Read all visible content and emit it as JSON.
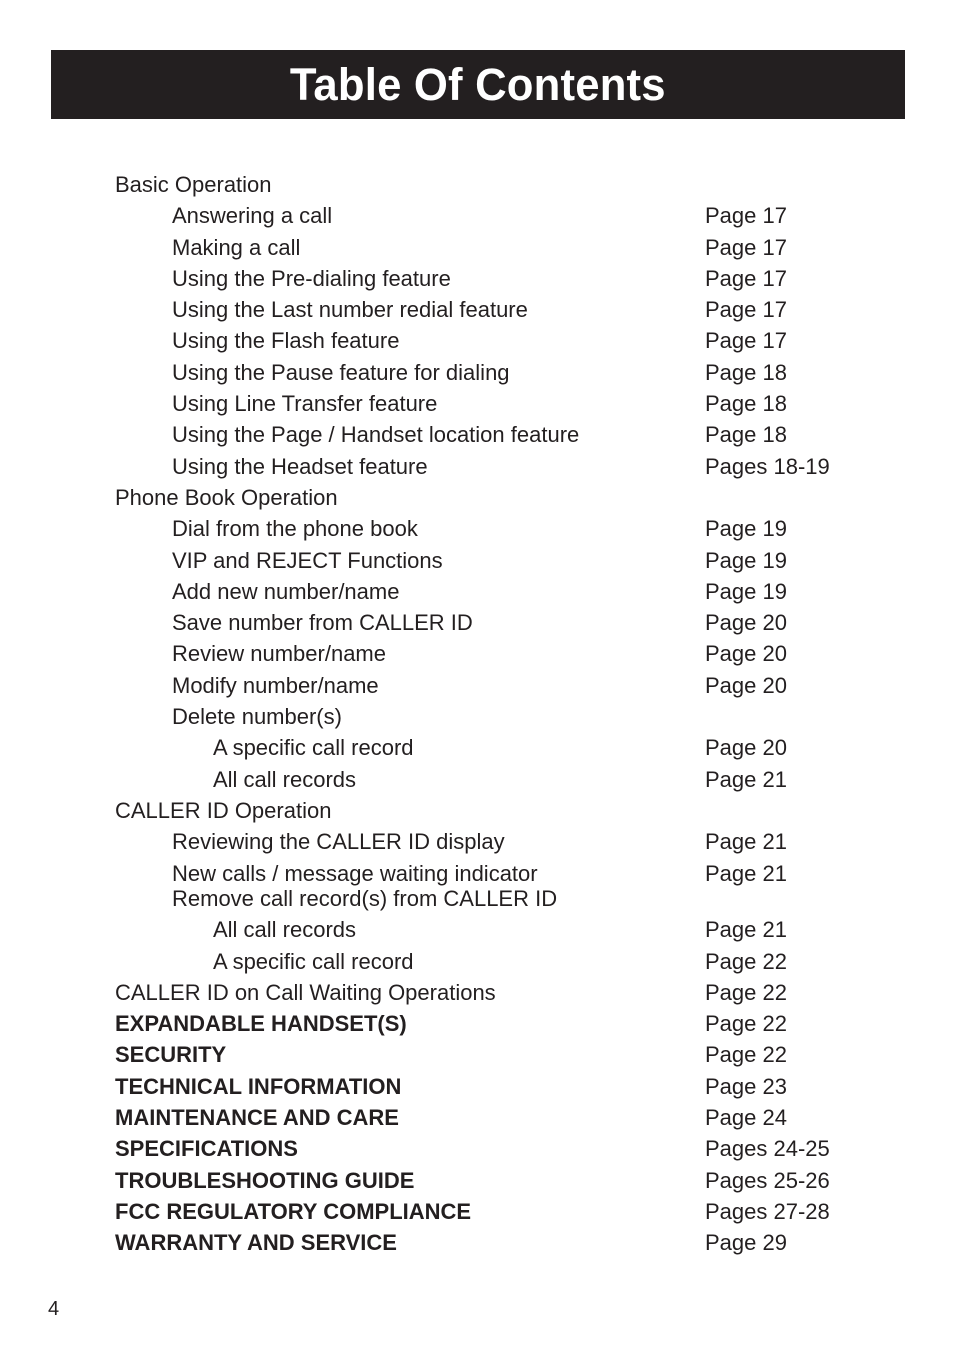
{
  "header": {
    "title": "Table Of Contents",
    "background_color": "#231f20",
    "text_color": "#ffffff"
  },
  "footer": {
    "page_number": "4"
  },
  "toc": {
    "rows": [
      {
        "label": "Basic Operation",
        "page": "",
        "level": 0,
        "bold": false,
        "tight": false
      },
      {
        "label": "Answering a call",
        "page": "Page 17",
        "level": 1,
        "bold": false,
        "tight": false
      },
      {
        "label": "Making a call",
        "page": "Page 17",
        "level": 1,
        "bold": false,
        "tight": false
      },
      {
        "label": "Using the Pre-dialing feature",
        "page": "Page 17",
        "level": 1,
        "bold": false,
        "tight": false
      },
      {
        "label": "Using the Last number redial feature",
        "page": "Page 17",
        "level": 1,
        "bold": false,
        "tight": false
      },
      {
        "label": "Using the Flash feature",
        "page": "Page 17",
        "level": 1,
        "bold": false,
        "tight": false
      },
      {
        "label": "Using the Pause feature for dialing",
        "page": "Page 18",
        "level": 1,
        "bold": false,
        "tight": false
      },
      {
        "label": "Using Line Transfer feature",
        "page": "Page 18",
        "level": 1,
        "bold": false,
        "tight": false
      },
      {
        "label": "Using the Page / Handset location feature",
        "page": "Page 18",
        "level": 1,
        "bold": false,
        "tight": false
      },
      {
        "label": "Using the Headset feature",
        "page": "Pages 18-19",
        "level": 1,
        "bold": false,
        "tight": false
      },
      {
        "label": "Phone Book Operation",
        "page": "",
        "level": 0,
        "bold": false,
        "tight": false
      },
      {
        "label": "Dial from the phone book",
        "page": "Page 19",
        "level": 1,
        "bold": false,
        "tight": false
      },
      {
        "label": "VIP and REJECT Functions",
        "page": "Page 19",
        "level": 1,
        "bold": false,
        "tight": false
      },
      {
        "label": "Add new number/name",
        "page": "Page 19",
        "level": 1,
        "bold": false,
        "tight": false
      },
      {
        "label": "Save number from CALLER ID",
        "page": "Page 20",
        "level": 1,
        "bold": false,
        "tight": false
      },
      {
        "label": "Review number/name",
        "page": "Page 20",
        "level": 1,
        "bold": false,
        "tight": false
      },
      {
        "label": "Modify number/name",
        "page": "Page 20",
        "level": 1,
        "bold": false,
        "tight": false
      },
      {
        "label": "Delete number(s)",
        "page": "",
        "level": 1,
        "bold": false,
        "tight": false
      },
      {
        "label": "A specific call record",
        "page": "Page 20",
        "level": 2,
        "bold": false,
        "tight": false
      },
      {
        "label": "All call records",
        "page": "Page 21",
        "level": 2,
        "bold": false,
        "tight": false
      },
      {
        "label": "CALLER ID Operation",
        "page": "",
        "level": 0,
        "bold": false,
        "tight": false
      },
      {
        "label": "Reviewing the CALLER ID display",
        "page": "Page 21",
        "level": 1,
        "bold": false,
        "tight": false
      },
      {
        "label": "New calls / message waiting indicator",
        "page": "Page 21",
        "level": 1,
        "bold": false,
        "tight": true
      },
      {
        "label": "Remove call record(s) from CALLER ID",
        "page": "",
        "level": 1,
        "bold": false,
        "tight": false
      },
      {
        "label": "All call records",
        "page": "Page 21",
        "level": 2,
        "bold": false,
        "tight": false
      },
      {
        "label": "A specific call record",
        "page": "Page 22",
        "level": 2,
        "bold": false,
        "tight": false
      },
      {
        "label": "CALLER ID on Call Waiting Operations",
        "page": "Page 22",
        "level": 0,
        "bold": false,
        "tight": false
      },
      {
        "label": "EXPANDABLE HANDSET(S)",
        "page": "Page 22",
        "level": 0,
        "bold": true,
        "tight": false
      },
      {
        "label": "SECURITY",
        "page": "Page 22",
        "level": 0,
        "bold": true,
        "tight": false
      },
      {
        "label": "TECHNICAL INFORMATION",
        "page": "Page 23",
        "level": 0,
        "bold": true,
        "tight": false
      },
      {
        "label": "MAINTENANCE AND CARE",
        "page": "Page 24",
        "level": 0,
        "bold": true,
        "tight": false
      },
      {
        "label": "SPECIFICATIONS",
        "page": "Pages 24-25",
        "level": 0,
        "bold": true,
        "tight": false
      },
      {
        "label": "TROUBLESHOOTING GUIDE",
        "page": "Pages 25-26",
        "level": 0,
        "bold": true,
        "tight": false
      },
      {
        "label": "FCC REGULATORY COMPLIANCE",
        "page": "Pages 27-28",
        "level": 0,
        "bold": true,
        "tight": false
      },
      {
        "label": "WARRANTY AND SERVICE",
        "page": "Page 29",
        "level": 0,
        "bold": true,
        "tight": false
      }
    ]
  }
}
